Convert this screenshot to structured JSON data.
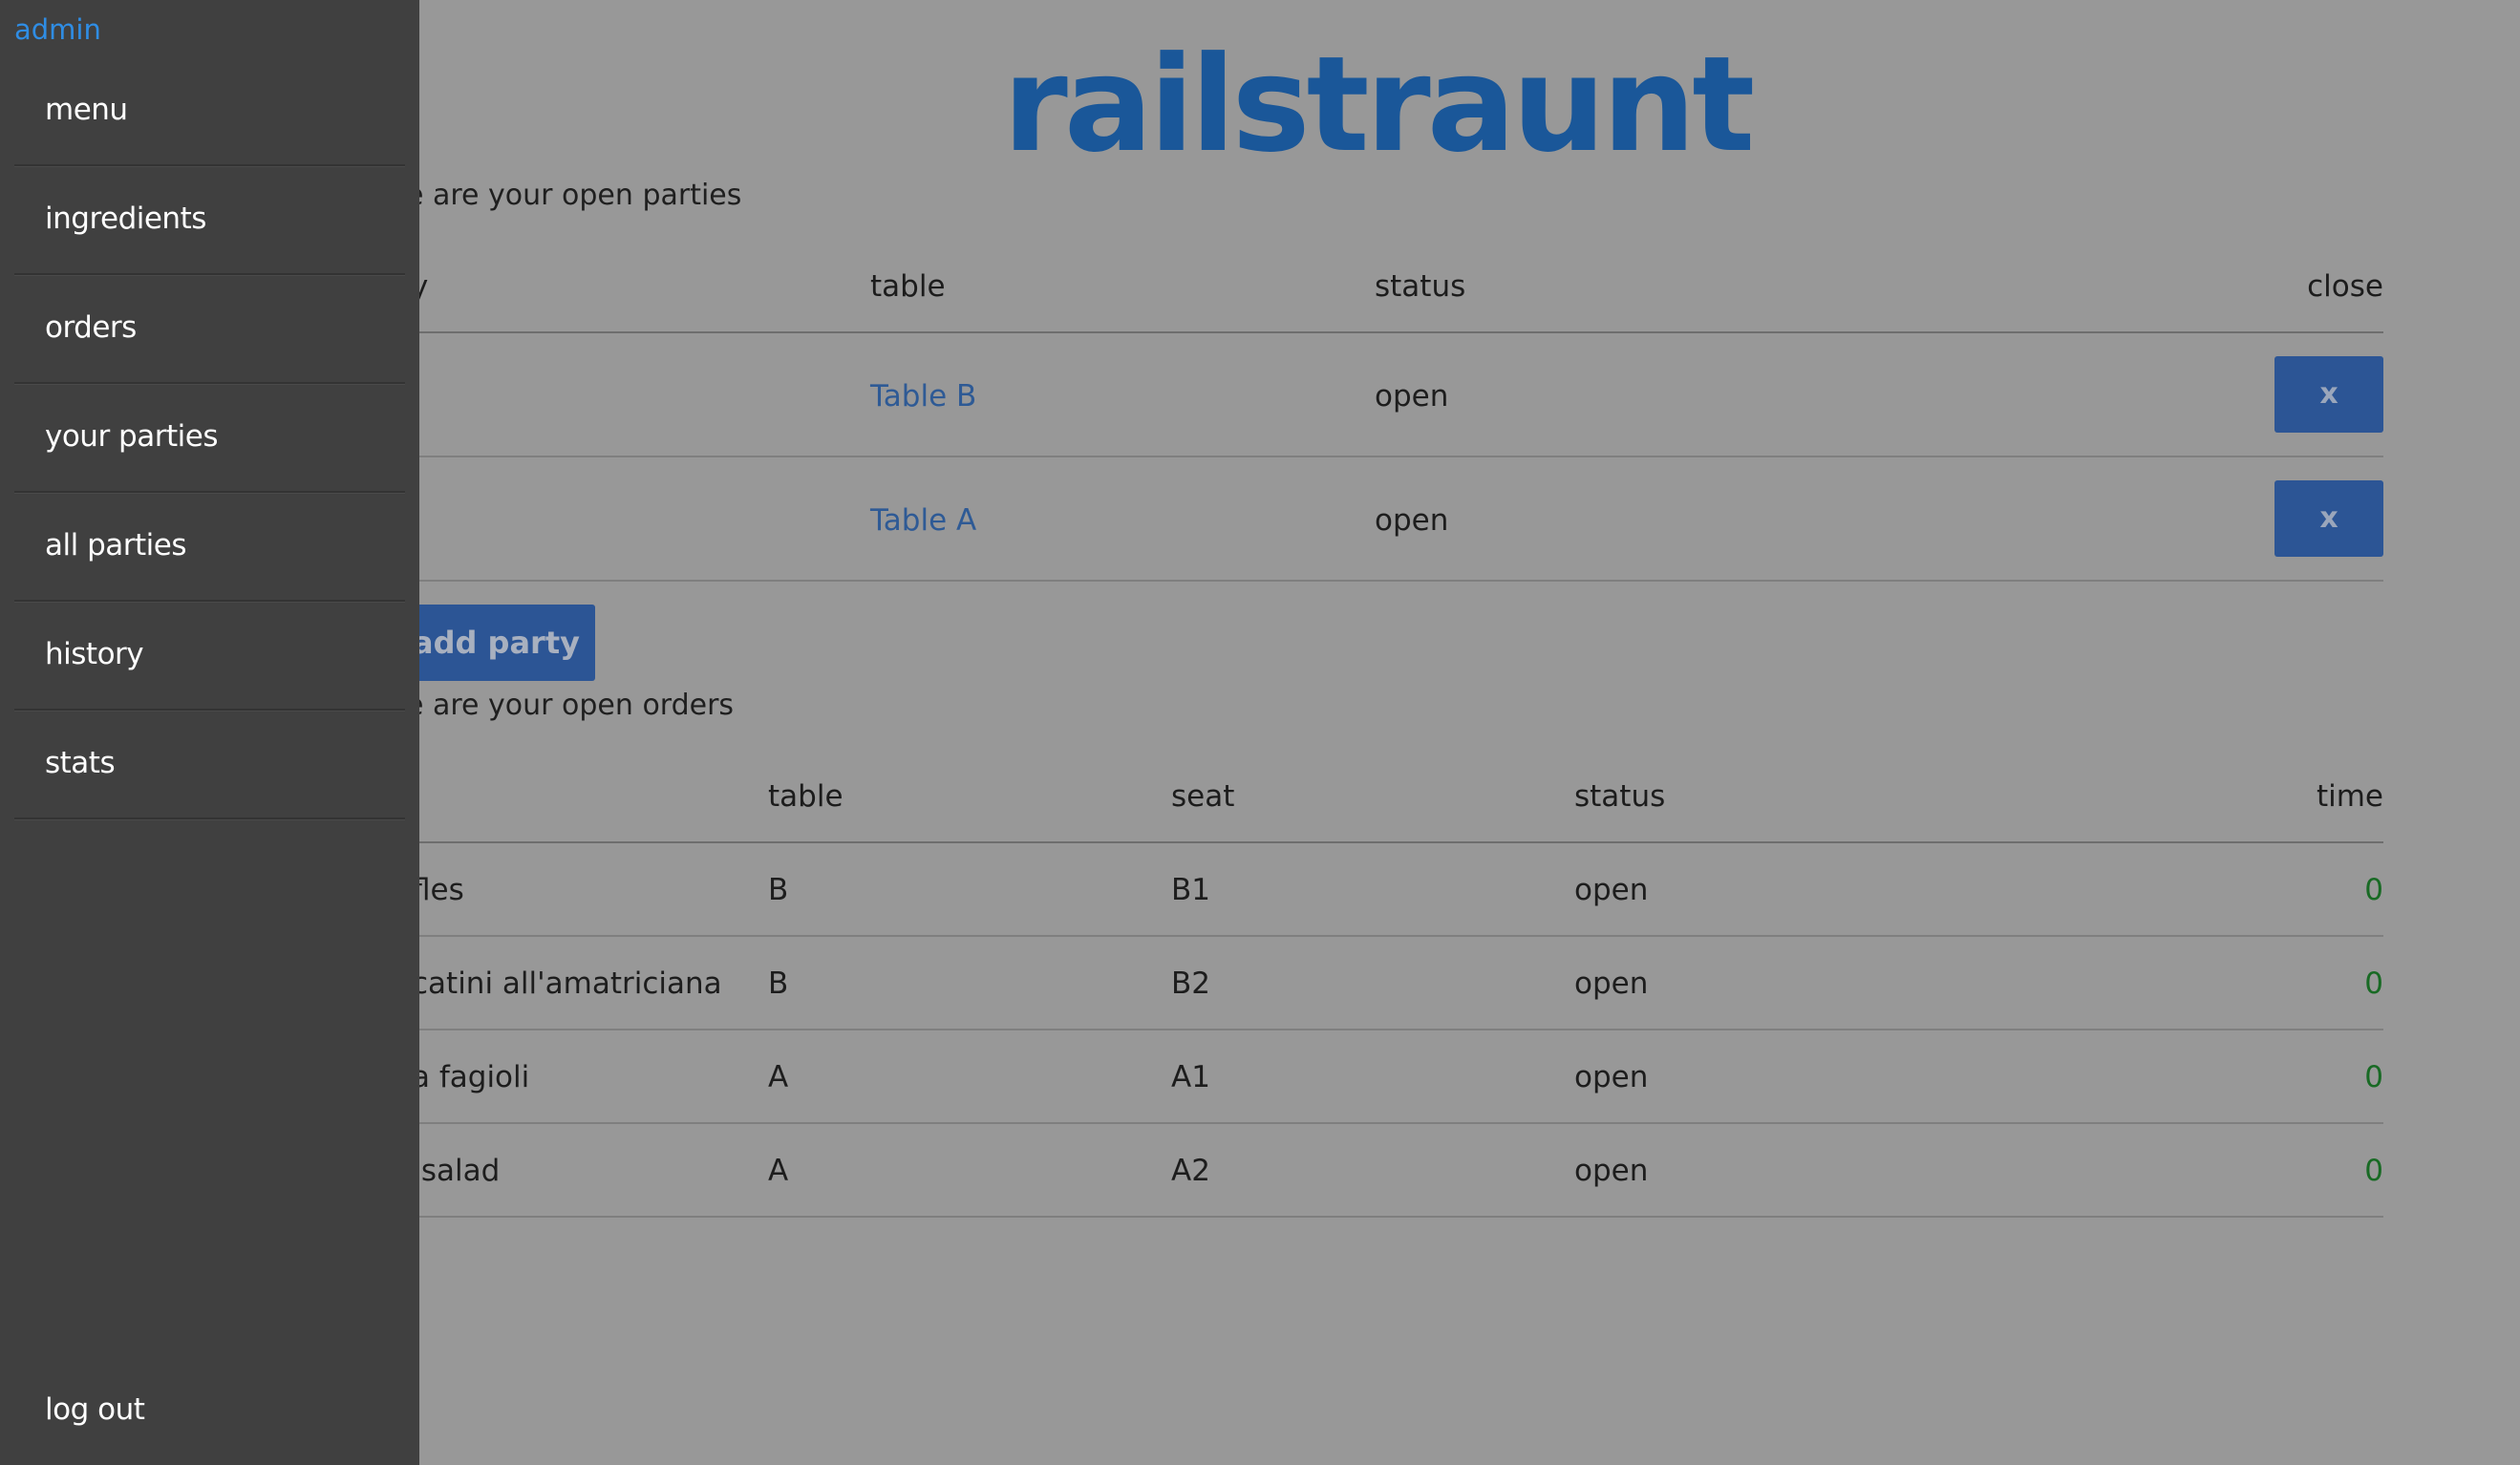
{
  "brand": {
    "logo_text": "railstraunt"
  },
  "drawer": {
    "user": "admin",
    "items": [
      {
        "label": "menu"
      },
      {
        "label": "ingredients"
      },
      {
        "label": "orders"
      },
      {
        "label": "your parties"
      },
      {
        "label": "all parties"
      },
      {
        "label": "history"
      },
      {
        "label": "stats"
      }
    ],
    "logout_label": "log out"
  },
  "parties": {
    "caption": "e are your open parties",
    "headers": {
      "party": "y",
      "table": "table",
      "status": "status",
      "close": "close"
    },
    "rows": [
      {
        "table": "Table B",
        "status": "open",
        "close_label": "x"
      },
      {
        "table": "Table A",
        "status": "open",
        "close_label": "x"
      }
    ],
    "add_button": "add party"
  },
  "orders": {
    "caption": "e are your open orders",
    "headers": {
      "table": "table",
      "seat": "seat",
      "status": "status",
      "time": "time"
    },
    "rows": [
      {
        "item": "fles",
        "table": "B",
        "seat": "B1",
        "status": "open",
        "time": "0"
      },
      {
        "item": "catini all'amatriciana",
        "table": "B",
        "seat": "B2",
        "status": "open",
        "time": "0"
      },
      {
        "item": "a fagioli",
        "table": "A",
        "seat": "A1",
        "status": "open",
        "time": "0"
      },
      {
        "item": " salad",
        "table": "A",
        "seat": "A2",
        "status": "open",
        "time": "0"
      }
    ]
  },
  "colors": {
    "drawer_bg": "#404040",
    "page_bg": "#989898",
    "brand": "#1a5799",
    "button": "#2c5595",
    "user_link": "#2f8de4",
    "time_value": "#186a24"
  }
}
